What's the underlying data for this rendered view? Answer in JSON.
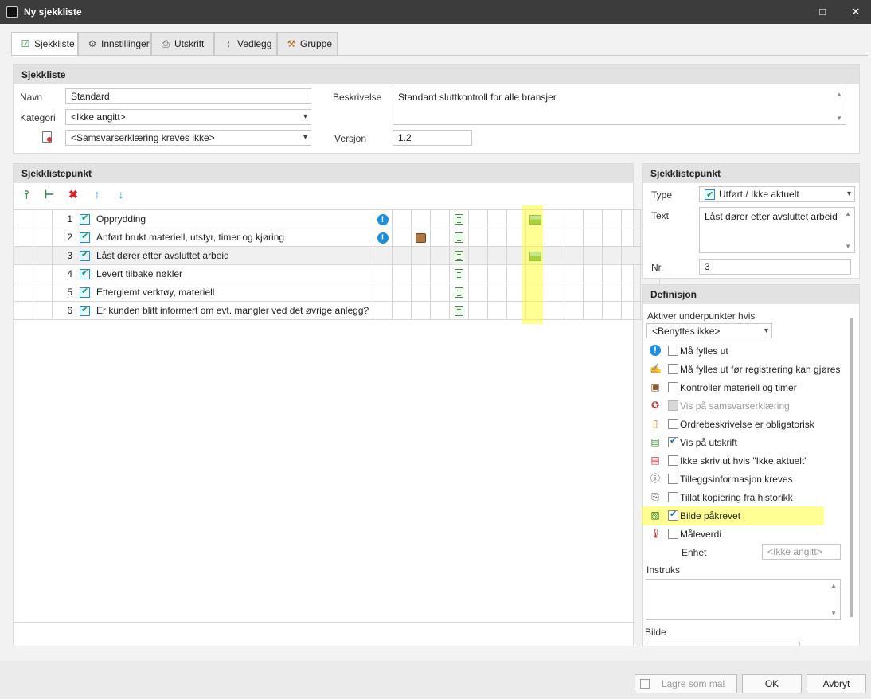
{
  "window": {
    "title": "Ny sjekkliste",
    "maximize": "□",
    "close": "✕"
  },
  "tabs": [
    {
      "label": "Sjekkliste",
      "icon": "checklist-icon"
    },
    {
      "label": "Innstillinger",
      "icon": "gear-icon"
    },
    {
      "label": "Utskrift",
      "icon": "printer-icon"
    },
    {
      "label": "Vedlegg",
      "icon": "paperclip-icon"
    },
    {
      "label": "Gruppe",
      "icon": "hammer-icon"
    }
  ],
  "sjekkliste": {
    "header": "Sjekkliste",
    "navn_label": "Navn",
    "navn_value": "Standard",
    "kategori_label": "Kategori",
    "kategori_value": "<Ikke angitt>",
    "samsvar_value": "<Samsvarserklæring kreves ikke>",
    "beskrivelse_label": "Beskrivelse",
    "beskrivelse_value": "Standard sluttkontroll for alle bransjer",
    "versjon_label": "Versjon",
    "versjon_value": "1.2"
  },
  "punkt_panel": {
    "header": "Sjekklistepunkt",
    "rows": [
      {
        "nr": "1",
        "text": "Opprydding",
        "required": true,
        "material": false,
        "print": true,
        "image": true
      },
      {
        "nr": "2",
        "text": "Anført brukt materiell, utstyr, timer og kjøring",
        "required": true,
        "material": true,
        "print": true,
        "image": false
      },
      {
        "nr": "3",
        "text": "Låst dører etter avsluttet arbeid",
        "required": false,
        "material": false,
        "print": true,
        "image": true
      },
      {
        "nr": "4",
        "text": "Levert tilbake nøkler",
        "required": false,
        "material": false,
        "print": true,
        "image": false
      },
      {
        "nr": "5",
        "text": "Etterglemt verktøy, materiell",
        "required": false,
        "material": false,
        "print": true,
        "image": false
      },
      {
        "nr": "6",
        "text": "Er kunden blitt informert om evt. mangler ved det øvrige anlegg?",
        "required": false,
        "material": false,
        "print": true,
        "image": false
      }
    ]
  },
  "punkt_detail": {
    "header": "Sjekklistepunkt",
    "type_label": "Type",
    "type_value": "Utført / Ikke aktuelt",
    "text_label": "Text",
    "text_value": "Låst dører etter avsluttet arbeid",
    "nr_label": "Nr.",
    "nr_value": "3"
  },
  "definisjon": {
    "header": "Definisjon",
    "aktiver_label": "Aktiver underpunkter hvis",
    "aktiver_value": "<Benyttes ikke>",
    "options": [
      {
        "label": "Må fylles ut",
        "checked": false,
        "icon": "exclamation-icon"
      },
      {
        "label": "Må fylles ut før registrering kan gjøres",
        "checked": false,
        "icon": "pencil-hand-icon"
      },
      {
        "label": "Kontroller materiell og timer",
        "checked": false,
        "icon": "box-icon"
      },
      {
        "label": "Vis på samsvarserklæring",
        "checked": false,
        "disabled": true,
        "icon": "seal-icon"
      },
      {
        "label": "Ordrebeskrivelse er obligatorisk",
        "checked": false,
        "icon": "clipboard-icon"
      },
      {
        "label": "Vis på utskrift",
        "checked": true,
        "icon": "document-icon"
      },
      {
        "label": "Ikke skriv ut hvis \"Ikke aktuelt\"",
        "checked": false,
        "icon": "document-red-icon"
      },
      {
        "label": "Tilleggsinformasjon kreves",
        "checked": false,
        "icon": "info-icon"
      },
      {
        "label": "Tillat kopiering fra historikk",
        "checked": false,
        "icon": "copy-history-icon"
      },
      {
        "label": "Bilde påkrevet",
        "checked": true,
        "icon": "image-icon"
      },
      {
        "label": "Måleverdi",
        "checked": false,
        "icon": "thermometer-icon"
      }
    ],
    "enhet_label": "Enhet",
    "enhet_placeholder": "<Ikke angitt>",
    "instruks_label": "Instruks",
    "bilde_label": "Bilde"
  },
  "buttons": {
    "save_template": "Lagre som mal",
    "ok": "OK",
    "cancel": "Avbryt"
  }
}
